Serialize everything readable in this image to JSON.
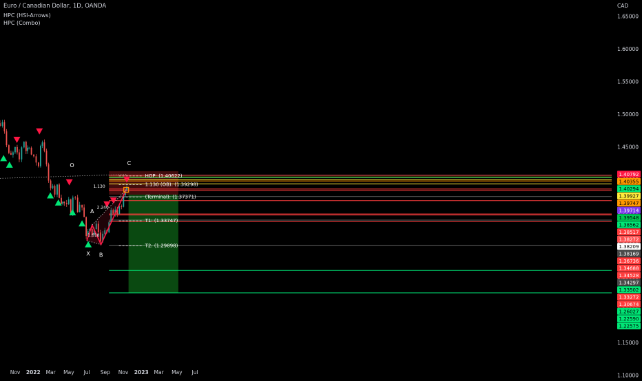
{
  "header": {
    "title": "Euro / Canadian Dollar, 1D, OANDA",
    "indicator_1": "HPC (HSI-Arrows)",
    "indicator_2": "HPC (Combo)"
  },
  "currency": "CAD",
  "colors": {
    "background": "#000000",
    "up": "#26a69a",
    "down": "#ef5350",
    "arrow_up": "#00e676",
    "arrow_down": "#ff1744",
    "target_zone": "#0b4d12",
    "axis_text": "#d1d4dc"
  },
  "chart_data": {
    "type": "candlestick",
    "x_ticks": [
      "Nov",
      "2022",
      "Mar",
      "May",
      "Jul",
      "Sep",
      "Nov",
      "2023",
      "Mar",
      "May",
      "Jul"
    ],
    "y_ticks": [
      "1.65000",
      "1.60000",
      "1.55000",
      "1.50000",
      "1.45000",
      "1.40000",
      "1.35000",
      "1.30000",
      "1.25000",
      "1.20000",
      "1.15000",
      "1.10000"
    ],
    "y_tick_values": [
      1.65,
      1.6,
      1.55,
      1.5,
      1.45,
      1.4,
      1.35,
      1.3,
      1.25,
      1.2,
      1.15,
      1.1
    ],
    "ylim": [
      1.095,
      1.675
    ],
    "grid": false,
    "price_path": [
      [
        "2021-09-20",
        1.486
      ],
      [
        "2021-09-28",
        1.49
      ],
      [
        "2021-10-05",
        1.475
      ],
      [
        "2021-10-12",
        1.452
      ],
      [
        "2021-10-20",
        1.438
      ],
      [
        "2021-10-27",
        1.436
      ],
      [
        "2021-11-03",
        1.44
      ],
      [
        "2021-11-10",
        1.447
      ],
      [
        "2021-11-17",
        1.438
      ],
      [
        "2021-11-24",
        1.43
      ],
      [
        "2021-12-02",
        1.45
      ],
      [
        "2021-12-10",
        1.459
      ],
      [
        "2021-12-17",
        1.444
      ],
      [
        "2021-12-27",
        1.452
      ],
      [
        "2022-01-04",
        1.438
      ],
      [
        "2022-01-12",
        1.432
      ],
      [
        "2022-01-20",
        1.427
      ],
      [
        "2022-01-28",
        1.42
      ],
      [
        "2022-02-04",
        1.453
      ],
      [
        "2022-02-10",
        1.458
      ],
      [
        "2022-02-17",
        1.446
      ],
      [
        "2022-02-24",
        1.42
      ],
      [
        "2022-03-03",
        1.398
      ],
      [
        "2022-03-10",
        1.383
      ],
      [
        "2022-03-17",
        1.392
      ],
      [
        "2022-03-24",
        1.378
      ],
      [
        "2022-04-01",
        1.389
      ],
      [
        "2022-04-08",
        1.375
      ],
      [
        "2022-04-15",
        1.366
      ],
      [
        "2022-04-25",
        1.363
      ],
      [
        "2022-05-03",
        1.359
      ],
      [
        "2022-05-10",
        1.366
      ],
      [
        "2022-05-17",
        1.349
      ],
      [
        "2022-05-24",
        1.376
      ],
      [
        "2022-06-01",
        1.37
      ],
      [
        "2022-06-09",
        1.352
      ],
      [
        "2022-06-16",
        1.362
      ],
      [
        "2022-06-24",
        1.357
      ],
      [
        "2022-07-01",
        1.341
      ],
      [
        "2022-07-08",
        1.31
      ],
      [
        "2022-07-14",
        1.32
      ],
      [
        "2022-07-20",
        1.326
      ],
      [
        "2022-07-28",
        1.318
      ],
      [
        "2022-08-04",
        1.322
      ],
      [
        "2022-08-11",
        1.335
      ],
      [
        "2022-08-18",
        1.317
      ],
      [
        "2022-08-25",
        1.302
      ],
      [
        "2022-09-02",
        1.313
      ],
      [
        "2022-09-09",
        1.324
      ],
      [
        "2022-09-16",
        1.32
      ],
      [
        "2022-09-23",
        1.331
      ],
      [
        "2022-09-30",
        1.352
      ],
      [
        "2022-10-07",
        1.346
      ],
      [
        "2022-10-14",
        1.355
      ],
      [
        "2022-10-21",
        1.346
      ],
      [
        "2022-10-28",
        1.361
      ],
      [
        "2022-11-04",
        1.358
      ],
      [
        "2022-11-11",
        1.372
      ],
      [
        "2022-11-17",
        1.384
      ],
      [
        "2022-11-22",
        1.388
      ]
    ],
    "arrows_up": [
      [
        "2021-10-02",
        1.432
      ],
      [
        "2021-10-22",
        1.422
      ],
      [
        "2022-03-09",
        1.375
      ],
      [
        "2022-04-05",
        1.364
      ],
      [
        "2022-05-23",
        1.349
      ],
      [
        "2022-06-24",
        1.332
      ],
      [
        "2022-07-15",
        1.3
      ]
    ],
    "arrows_down": [
      [
        "2021-11-16",
        1.461
      ],
      [
        "2022-01-31",
        1.474
      ],
      [
        "2022-05-12",
        1.396
      ],
      [
        "2022-09-16",
        1.362
      ],
      [
        "2022-10-08",
        1.368
      ],
      [
        "2022-11-22",
        1.4
      ]
    ],
    "pattern": [
      [
        "2022-07-10",
        1.306
      ],
      [
        "2022-07-28",
        1.33
      ],
      [
        "2022-08-27",
        1.3
      ],
      [
        "2022-11-20",
        1.384
      ]
    ],
    "pattern_labels": [
      {
        "label": "O",
        "date": "2022-05-21",
        "price": 1.419
      },
      {
        "label": "X",
        "date": "2022-07-15",
        "price": 1.283
      },
      {
        "label": "A",
        "date": "2022-07-28",
        "price": 1.348
      },
      {
        "label": "B",
        "date": "2022-08-27",
        "price": 1.281
      },
      {
        "label": "C",
        "date": "2022-11-30",
        "price": 1.422
      }
    ],
    "ratio_labels": [
      {
        "label": "1.618",
        "date": "2022-08-02",
        "price": 1.312
      },
      {
        "label": "2.240",
        "date": "2022-09-02",
        "price": 1.355
      },
      {
        "label": "1.130",
        "date": "2022-08-21",
        "price": 1.387
      }
    ],
    "levels": [
      {
        "name": "HOP: (1.40622)",
        "price": 1.40622,
        "color": "#ef5350"
      },
      {
        "name": "1.130 (OB): (1.39298)",
        "price": 1.39298,
        "color": "#ffeb3b"
      },
      {
        "name": "(Terminal): (1.37371)",
        "price": 1.37371,
        "color": "#ffffff"
      },
      {
        "name": "T1: (1.33747)",
        "price": 1.33747,
        "color": "#ffffff"
      },
      {
        "name": "T2: (1.29898)",
        "price": 1.29898,
        "color": "#ffffff"
      }
    ],
    "hlines": [
      {
        "price": 1.40355,
        "color": "#ff9800"
      },
      {
        "price": 1.40294,
        "color": "#00e676"
      },
      {
        "price": 1.39927,
        "color": "#ffeb3b"
      },
      {
        "price": 1.39747,
        "color": "#ff9800"
      },
      {
        "price": 1.38517,
        "color": "#ff3d3d"
      },
      {
        "price": 1.38272,
        "color": "#ff3d3d"
      },
      {
        "price": 1.36736,
        "color": "#ff3d3d"
      },
      {
        "price": 1.34688,
        "color": "#ff3d3d"
      },
      {
        "price": 1.34528,
        "color": "#ff3d3d"
      },
      {
        "price": 1.33502,
        "color": "#ff3d3d"
      },
      {
        "price": 1.26027,
        "color": "#00e676"
      },
      {
        "price": 1.2259,
        "color": "#00e676"
      }
    ],
    "target_zone": {
      "start": "2022-11-28",
      "end": "2023-05-15",
      "top": 1.3765,
      "bottom": 1.2259
    },
    "risk_zone": {
      "start": "2022-09-23",
      "end": "2023-05-15",
      "top": 1.4125,
      "bottom": 1.3765
    },
    "level_start": "2022-09-23",
    "price_badges": [
      {
        "text": "1.40792",
        "price": 1.40792,
        "bg": "#ff1744",
        "fg": "#ffffff"
      },
      {
        "text": "1.40355",
        "price": 1.40355,
        "bg": "#ff9800",
        "fg": "#000000"
      },
      {
        "text": "1.40294",
        "price": 1.40294,
        "bg": "#00e676",
        "fg": "#000000"
      },
      {
        "text": "1.39927",
        "price": 1.39927,
        "bg": "#ffeb3b",
        "fg": "#000000"
      },
      {
        "text": "1.39747",
        "price": 1.39747,
        "bg": "#ff9800",
        "fg": "#000000"
      },
      {
        "text": "1.39714",
        "price": 1.39714,
        "bg": "#7c3aed",
        "fg": "#ffffff"
      },
      {
        "text": "1.39548",
        "price": 1.39548,
        "bg": "#00c853",
        "fg": "#000000"
      },
      {
        "text": "1.38562",
        "price": 1.38562,
        "bg": "#00e676",
        "fg": "#000000"
      },
      {
        "text": "1.38517",
        "price": 1.38517,
        "bg": "#ff3d3d",
        "fg": "#ffffff"
      },
      {
        "text": "1.38272",
        "price": 1.38272,
        "bg": "#ff5252",
        "fg": "#ffffff"
      },
      {
        "text": "1.38209",
        "price": 1.38209,
        "bg": "#ffffff",
        "fg": "#000000"
      },
      {
        "text": "1.38169",
        "price": 1.38169,
        "bg": "#4a4a4a",
        "fg": "#ffffff"
      },
      {
        "text": "1.36736",
        "price": 1.36736,
        "bg": "#ff3d3d",
        "fg": "#ffffff"
      },
      {
        "text": "1.34688",
        "price": 1.34688,
        "bg": "#ff3d3d",
        "fg": "#ffffff"
      },
      {
        "text": "1.34528",
        "price": 1.34528,
        "bg": "#ff3d3d",
        "fg": "#ffffff"
      },
      {
        "text": "1.34297",
        "price": 1.34297,
        "bg": "#4a4a4a",
        "fg": "#ffffff"
      },
      {
        "text": "1.33502",
        "price": 1.33502,
        "bg": "#00e676",
        "fg": "#000000"
      },
      {
        "text": "1.33272",
        "price": 1.33272,
        "bg": "#ff3d3d",
        "fg": "#ffffff"
      },
      {
        "text": "1.30674",
        "price": 1.30674,
        "bg": "#ff3d3d",
        "fg": "#ffffff"
      },
      {
        "text": "1.26027",
        "price": 1.26027,
        "bg": "#00e676",
        "fg": "#000000"
      },
      {
        "text": "1.22590",
        "price": 1.2259,
        "bg": "#00e676",
        "fg": "#000000"
      },
      {
        "text": "1.22575",
        "price": 1.22575,
        "bg": "#00e676",
        "fg": "#000000"
      }
    ]
  }
}
